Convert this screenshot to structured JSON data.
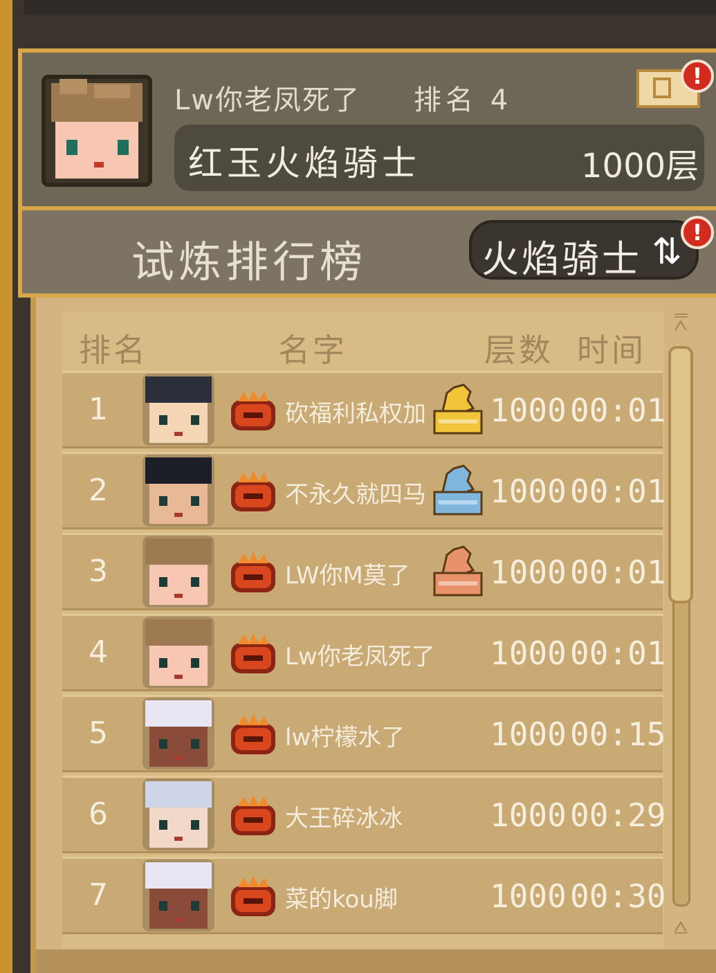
{
  "player": {
    "name": "Lw你老凤死了",
    "rank_label": "排名",
    "rank_value": "4",
    "title": "红玉火焰骑士",
    "floor": "1000层"
  },
  "board": {
    "title": "试炼排行榜",
    "class_switch_label": "火焰骑士",
    "badge": "!"
  },
  "headers": {
    "rank": "排名",
    "name": "名字",
    "floor": "层数",
    "time": "时间"
  },
  "rows": [
    {
      "rank": "1",
      "name": "砍福利私权加",
      "floor": "1000",
      "time": "00:01",
      "trophy": "gold"
    },
    {
      "rank": "2",
      "name": "不永久就四马",
      "floor": "1000",
      "time": "00:01",
      "trophy": "silver"
    },
    {
      "rank": "3",
      "name": "LW你M莫了",
      "floor": "1000",
      "time": "00:01",
      "trophy": "bronze"
    },
    {
      "rank": "4",
      "name": "Lw你老凤死了",
      "floor": "1000",
      "time": "00:01",
      "trophy": ""
    },
    {
      "rank": "5",
      "name": "lw柠檬水了",
      "floor": "1000",
      "time": "00:15",
      "trophy": ""
    },
    {
      "rank": "6",
      "name": "大王碎冰冰",
      "floor": "1000",
      "time": "00:29",
      "trophy": ""
    },
    {
      "rank": "7",
      "name": "菜的kou脚",
      "floor": "1000",
      "time": "00:30",
      "trophy": ""
    }
  ],
  "colors": {
    "gold": "#f2c43a",
    "silver": "#7fb6de",
    "bronze": "#e7926a",
    "badge": "#d32b1d"
  },
  "icons": {
    "class": "flame-helmet-icon",
    "switch": "swap-icon",
    "ticket": "ticket-icon"
  }
}
